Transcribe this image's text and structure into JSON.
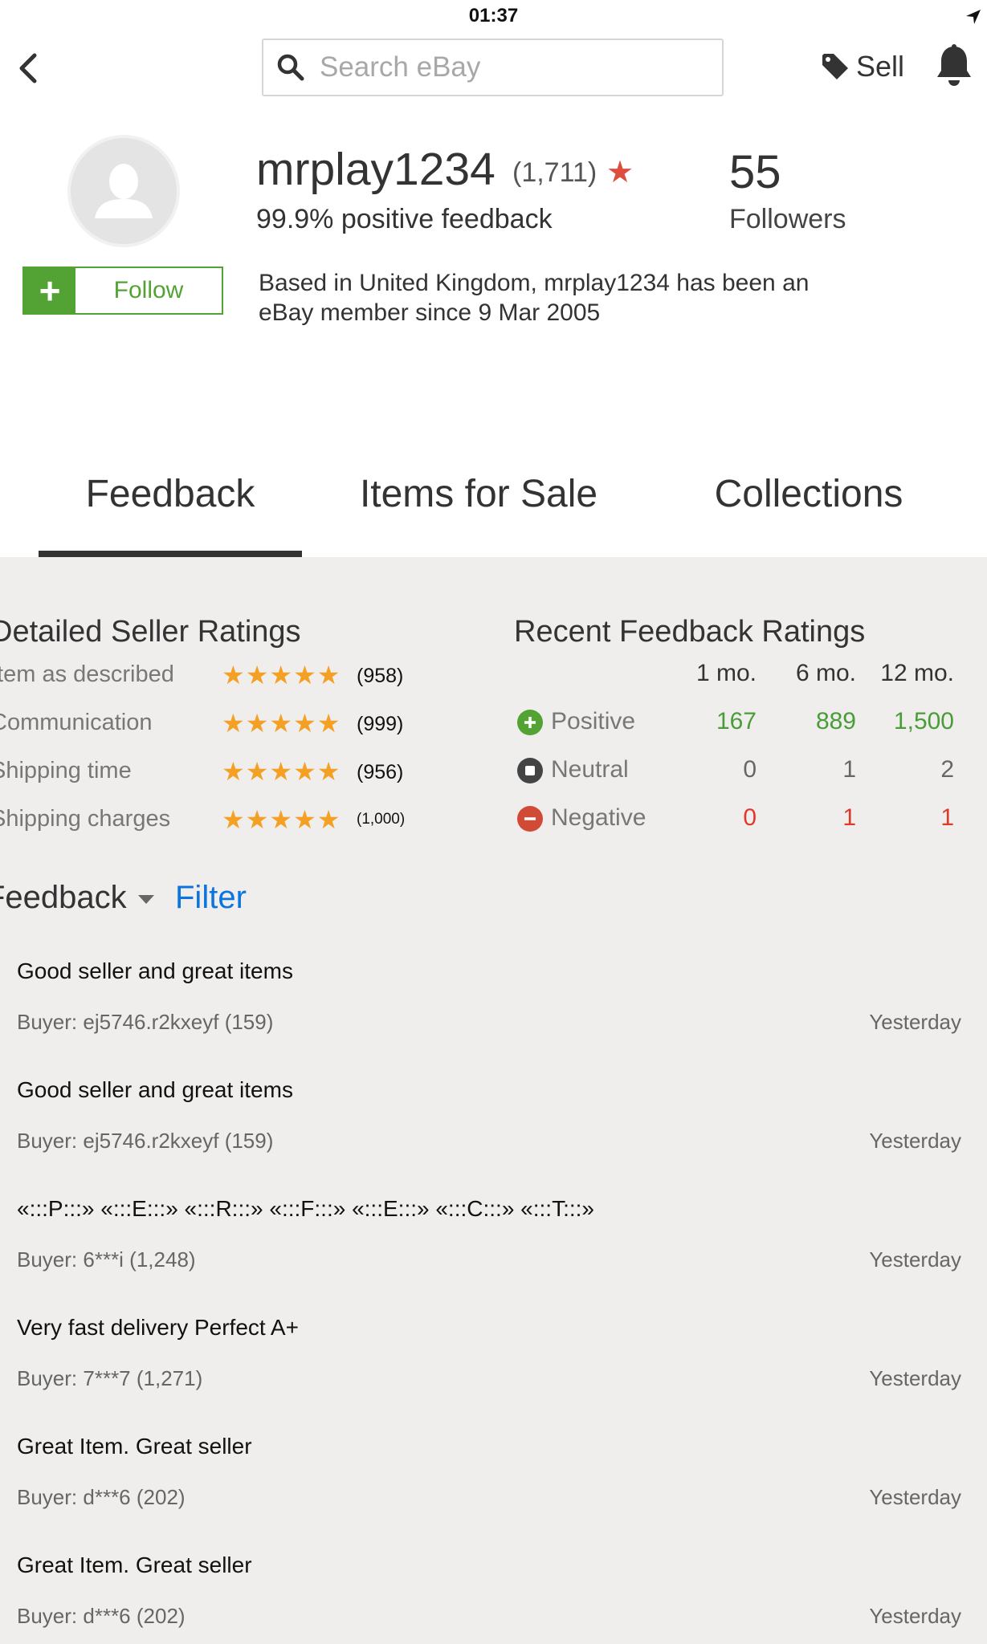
{
  "status_bar": {
    "time": "01:37"
  },
  "header": {
    "search_placeholder": "Search eBay",
    "sell_label": "Sell"
  },
  "profile": {
    "username": "mrplay1234",
    "feedback_score": "(1,711)",
    "star": "★",
    "positive_feedback": "99.9% positive feedback",
    "followers_count": "55",
    "followers_label": "Followers",
    "follow_label": "Follow",
    "member_info": "Based in United Kingdom, mrplay1234 has been an eBay member since 9 Mar 2005"
  },
  "tabs": [
    {
      "label": "Feedback",
      "active": true
    },
    {
      "label": "Items for Sale",
      "active": false
    },
    {
      "label": "Collections",
      "active": false
    }
  ],
  "detailed_seller_ratings": {
    "title": "Detailed Seller Ratings",
    "stars": "★★★★★",
    "rows": [
      {
        "label": "Item as described",
        "count": "(958)",
        "rating": 5
      },
      {
        "label": "Communication",
        "count": "(999)",
        "rating": 5
      },
      {
        "label": "Shipping time",
        "count": "(956)",
        "rating": 5
      },
      {
        "label": "Shipping charges",
        "count": "(1,000)",
        "rating": 5
      }
    ]
  },
  "recent_feedback_ratings": {
    "title": "Recent Feedback Ratings",
    "columns": [
      "1 mo.",
      "6 mo.",
      "12 mo."
    ],
    "rows": [
      {
        "label": "Positive",
        "values": [
          "167",
          "889",
          "1,500"
        ],
        "color": "#4a9c38"
      },
      {
        "label": "Neutral",
        "values": [
          "0",
          "1",
          "2"
        ],
        "color": "#333333"
      },
      {
        "label": "Negative",
        "values": [
          "0",
          "1",
          "1"
        ],
        "color": "#dd3a2c"
      }
    ]
  },
  "feedback_controls": {
    "dropdown_label": "Feedback",
    "filter_label": "Filter"
  },
  "feedback_list": [
    {
      "comment": "Good seller and great items",
      "buyer": "Buyer: ej5746.r2kxeyf (159)",
      "date": "Yesterday"
    },
    {
      "comment": "Good seller and great items",
      "buyer": "Buyer: ej5746.r2kxeyf (159)",
      "date": "Yesterday"
    },
    {
      "comment": "«:::P:::» «:::E:::» «:::R:::» «:::F:::» «:::E:::» «:::C:::» «:::T:::»",
      "buyer": "Buyer: 6***i (1,248)",
      "date": "Yesterday"
    },
    {
      "comment": "Very fast delivery Perfect A+",
      "buyer": "Buyer: 7***7 (1,271)",
      "date": "Yesterday"
    },
    {
      "comment": "Great Item. Great seller",
      "buyer": "Buyer: d***6 (202)",
      "date": "Yesterday"
    },
    {
      "comment": "Great Item. Great seller",
      "buyer": "Buyer: d***6 (202)",
      "date": "Yesterday"
    }
  ],
  "colors": {
    "accent_green": "#52a334",
    "link_blue": "#0b74de",
    "star_orange": "#f4a025",
    "star_red": "#dd4e3f",
    "content_background": "#efeeed"
  }
}
